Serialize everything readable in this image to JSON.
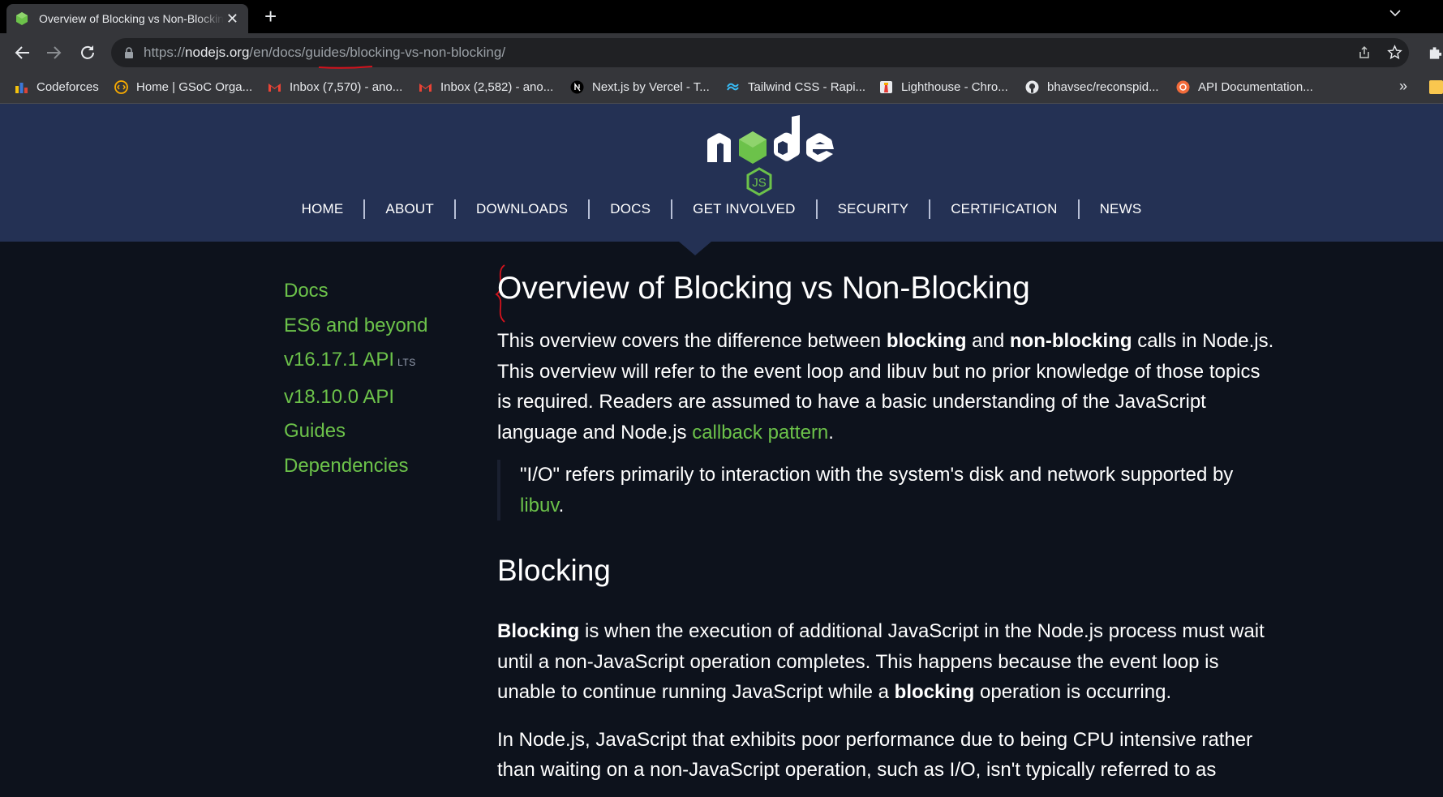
{
  "browser": {
    "tab_title": "Overview of Blocking vs Non-Blocking | Node.js",
    "url_scheme": "https://",
    "url_host": "nodejs.org",
    "url_path": "/en/docs/guides/blocking-vs-non-blocking/",
    "bookmarks": [
      {
        "label": "Codeforces",
        "icon": "codeforces-icon"
      },
      {
        "label": "Home | GSoC Orga...",
        "icon": "gsoc-icon"
      },
      {
        "label": "Inbox (7,570) - ano...",
        "icon": "gmail-icon"
      },
      {
        "label": "Inbox (2,582) - ano...",
        "icon": "gmail-icon"
      },
      {
        "label": "Next.js by Vercel - T...",
        "icon": "nextjs-icon"
      },
      {
        "label": "Tailwind CSS - Rapi...",
        "icon": "tailwind-icon"
      },
      {
        "label": "Lighthouse - Chro...",
        "icon": "lighthouse-icon"
      },
      {
        "label": "bhavsec/reconspid...",
        "icon": "github-icon"
      },
      {
        "label": "API Documentation...",
        "icon": "api-icon"
      }
    ],
    "bookmarks_more": "»"
  },
  "site": {
    "nav": [
      "HOME",
      "ABOUT",
      "DOWNLOADS",
      "DOCS",
      "GET INVOLVED",
      "SECURITY",
      "CERTIFICATION",
      "NEWS"
    ],
    "active_nav": "DOCS",
    "colors": {
      "header_bg": "#243154",
      "page_bg": "#0d121c",
      "link_green": "#6cc24a"
    }
  },
  "sidebar": {
    "items": [
      "Docs",
      "ES6 and beyond",
      "v16.17.1 API",
      "v18.10.0 API",
      "Guides",
      "Dependencies"
    ],
    "lts_badge": "LTS"
  },
  "article": {
    "title": "Overview of Blocking vs Non-Blocking",
    "intro": {
      "t1": "This overview covers the difference between ",
      "b1": "blocking",
      "t2": " and ",
      "b2": "non-blocking",
      "t3": " calls in Node.js. This overview will refer to the event loop and libuv but no prior knowledge of those topics is required. Readers are assumed to have a basic understanding of the JavaScript language and Node.js ",
      "link": "callback pattern",
      "t4": "."
    },
    "quote": {
      "text": "\"I/O\" refers primarily to interaction with the system's disk and network supported by ",
      "link": "libuv",
      "end": "."
    },
    "section_heading": "Blocking",
    "blocking_para": {
      "b1": "Blocking",
      "t1": " is when the execution of additional JavaScript in the Node.js process must wait until a non-JavaScript operation completes. This happens because the event loop is unable to continue running JavaScript while a ",
      "b2": "blocking",
      "t2": " operation is occurring."
    },
    "cpu_para": "In Node.js, JavaScript that exhibits poor performance due to being CPU intensive rather than waiting on a non-JavaScript operation, such as I/O, isn't typically referred to as"
  }
}
